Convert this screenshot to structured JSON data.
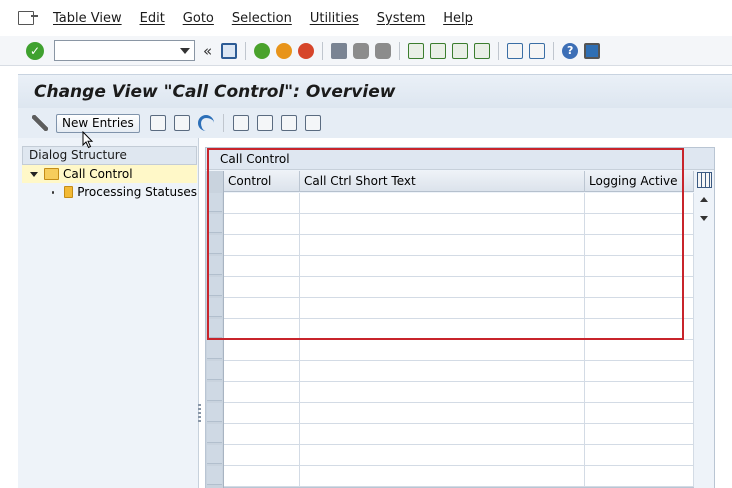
{
  "menu": {
    "items": [
      "Table View",
      "Edit",
      "Goto",
      "Selection",
      "Utilities",
      "System",
      "Help"
    ]
  },
  "toolbar": {
    "command_value": "",
    "back_glyph": "«"
  },
  "title": "Change View \"Call Control\": Overview",
  "app_toolbar": {
    "new_entries_label": "New Entries"
  },
  "dialog_structure": {
    "header": "Dialog Structure",
    "nodes": [
      {
        "label": "Call Control",
        "selected": true,
        "expanded": true
      },
      {
        "label": "Processing Statuses",
        "selected": false,
        "expanded": false
      }
    ]
  },
  "table": {
    "title": "Call Control",
    "columns": [
      "Control",
      "Call Ctrl Short Text",
      "Logging Active"
    ],
    "row_count": 14
  },
  "colors": {
    "accent": "#c8242b",
    "selected_node": "#fff8c8",
    "header_bg": "#dfe7f1"
  },
  "icons": [
    "menu-icon",
    "enter-check-icon",
    "save-icon",
    "back-icon",
    "exit-icon",
    "cancel-icon",
    "print-icon",
    "find-icon",
    "find-next-icon",
    "first-page-icon",
    "previous-page-icon",
    "next-page-icon",
    "last-page-icon",
    "create-session-icon",
    "shortcut-icon",
    "help-icon",
    "layout-icon",
    "display-change-icon",
    "copy-icon",
    "delete-icon",
    "undo-icon",
    "select-all-icon",
    "select-block-icon",
    "deselect-all-icon",
    "print-view-icon",
    "folder-icon",
    "column-config-icon"
  ]
}
